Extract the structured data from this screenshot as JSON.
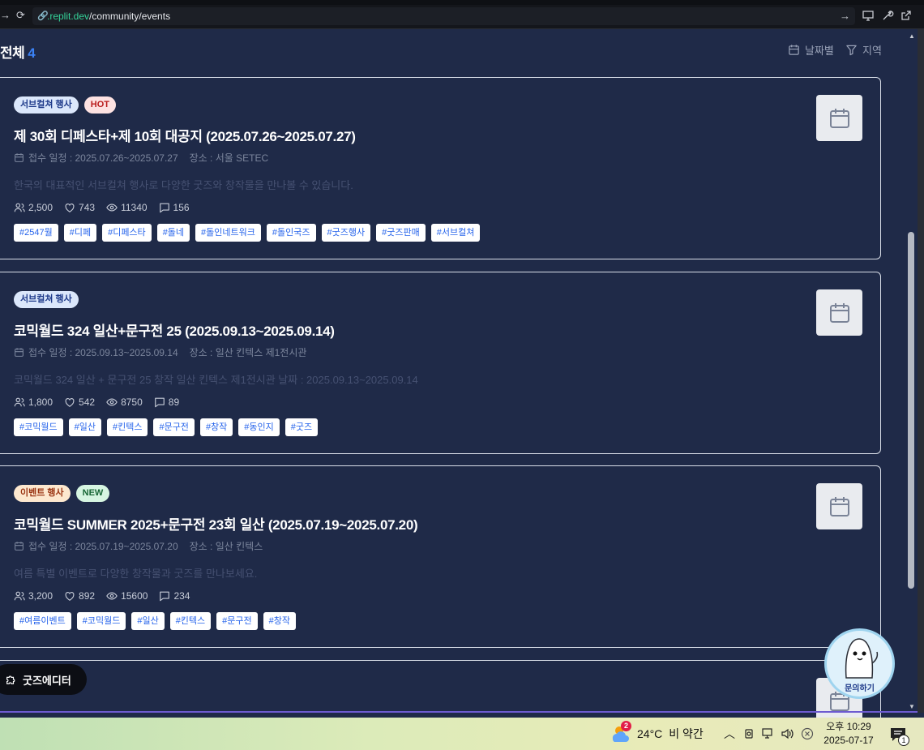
{
  "browser": {
    "url_domain": ".replit.dev",
    "url_path": "/community/events"
  },
  "header": {
    "total_label": "전체",
    "total_count": "4",
    "sort_date_label": "날짜별",
    "filter_region_label": "지역"
  },
  "events": [
    {
      "badges": [
        {
          "label": "서브컬쳐 행사",
          "type": "sub"
        },
        {
          "label": "HOT",
          "type": "hot"
        }
      ],
      "title": "제 30회 디페스타+제 10회 대공지 (2025.07.26~2025.07.27)",
      "schedule": "접수 일정 : 2025.07.26~2025.07.27",
      "location": "장소 : 서울 SETEC",
      "description": "한국의 대표적인 서브컬쳐 행사로 다양한 굿즈와 창작물을 만나볼 수 있습니다.",
      "participants": "2,500",
      "likes": "743",
      "views": "11340",
      "comments": "156",
      "tags": [
        "#2547월",
        "#디페",
        "#디페스타",
        "#돌네",
        "#돌인네트워크",
        "#돌인국즈",
        "#굿즈행사",
        "#굿즈판매",
        "#서브컬쳐"
      ]
    },
    {
      "badges": [
        {
          "label": "서브컬쳐 행사",
          "type": "sub"
        }
      ],
      "title": "코믹월드 324 일산+문구전 25 (2025.09.13~2025.09.14)",
      "schedule": "접수 일정 : 2025.09.13~2025.09.14",
      "location": "장소 : 일산 킨텍스 제1전시관",
      "description": "코믹월드 324 일산 + 문구전 25 창작 일산 킨텍스 제1전시관 날짜 : 2025.09.13~2025.09.14",
      "participants": "1,800",
      "likes": "542",
      "views": "8750",
      "comments": "89",
      "tags": [
        "#코믹월드",
        "#일산",
        "#킨텍스",
        "#문구전",
        "#창작",
        "#동인지",
        "#굿즈"
      ]
    },
    {
      "badges": [
        {
          "label": "이벤트 행사",
          "type": "event"
        },
        {
          "label": "NEW",
          "type": "new"
        }
      ],
      "title": "코믹월드 SUMMER 2025+문구전 23회 일산 (2025.07.19~2025.07.20)",
      "schedule": "접수 일정 : 2025.07.19~2025.07.20",
      "location": "장소 : 일산 킨텍스",
      "description": "여름 특별 이벤트로 다양한 창작물과 굿즈를 만나보세요.",
      "participants": "3,200",
      "likes": "892",
      "views": "15600",
      "comments": "234",
      "tags": [
        "#여름이벤트",
        "#코믹월드",
        "#일산",
        "#킨텍스",
        "#문구전",
        "#창작"
      ]
    }
  ],
  "floating": {
    "goods_editor_label": "굿즈에디터",
    "inquiry_label": "문의하기"
  },
  "taskbar": {
    "weather_badge": "2",
    "temperature": "24°C",
    "weather_text": "비 약간",
    "time": "오후 10:29",
    "date": "2025-07-17",
    "notification_count": "1"
  },
  "colors": {
    "page_bg": "#1f2a48",
    "accent": "#3b82f6",
    "tag_text": "#2563eb"
  }
}
